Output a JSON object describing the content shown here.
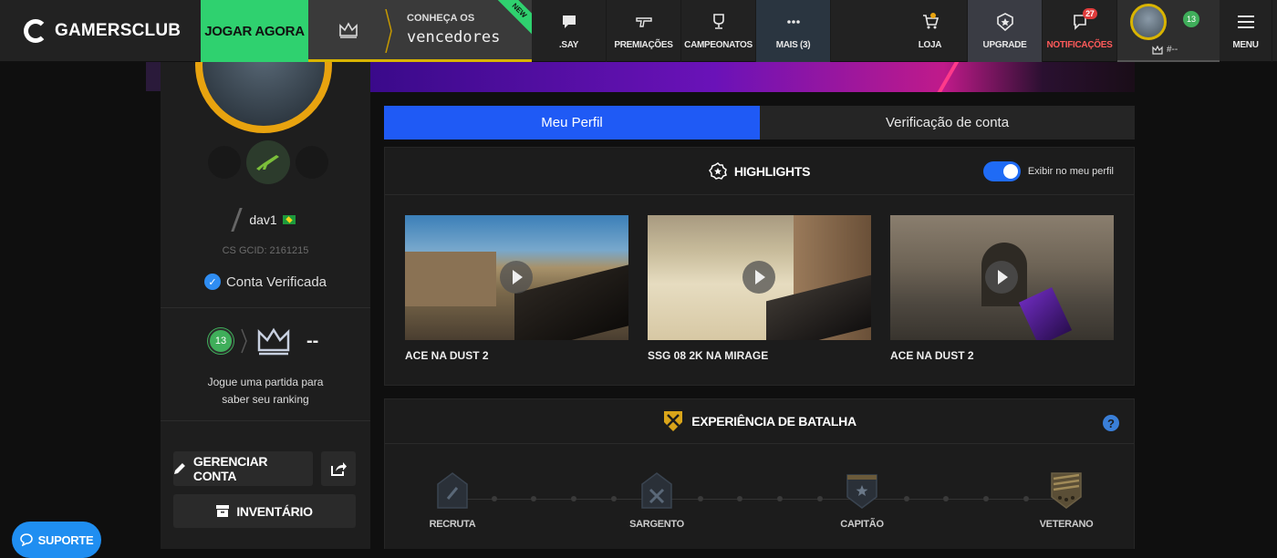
{
  "brand": {
    "name": "GAMERSCLUB"
  },
  "topnav": {
    "play_now": "JOGAR AGORA",
    "promo": {
      "line1": "CONHEÇA OS",
      "line2": "vencedores",
      "ribbon": "NEW"
    },
    "items": [
      {
        "label": ".SAY",
        "icon": "chat-icon"
      },
      {
        "label": "PREMIAÇÕES",
        "icon": "gun-icon"
      },
      {
        "label": "CAMPEONATOS",
        "icon": "trophy-icon"
      },
      {
        "label": "MAIS (3)",
        "icon": "more-dots-icon"
      },
      {
        "label": "LOJA",
        "icon": "cart-icon"
      },
      {
        "label": "UPGRADE",
        "icon": "upgrade-shield-icon"
      },
      {
        "label": "NOTIFICAÇÕES",
        "icon": "bell-icon",
        "badge": "27"
      }
    ],
    "user": {
      "level": "13",
      "rank": "#--"
    },
    "menu_label": "MENU"
  },
  "sidebar": {
    "nickname": "dav1",
    "gcid": "CS GCID: 2161215",
    "verified": "Conta Verificada",
    "level": "13",
    "rank_value": "--",
    "rank_message_1": "Jogue uma partida para",
    "rank_message_2": "saber seu ranking",
    "manage_button": "GERENCIAR CONTA",
    "inventory_button": "INVENTÁRIO"
  },
  "support_button": "SUPORTE",
  "tabs": [
    {
      "label": "Meu Perfil",
      "active": true
    },
    {
      "label": "Verificação de conta",
      "active": false
    }
  ],
  "highlights": {
    "title": "HIGHLIGHTS",
    "toggle_label": "Exibir no meu perfil",
    "toggle_on": true,
    "videos": [
      {
        "title": "ACE NA DUST 2"
      },
      {
        "title": "SSG 08 2K NA MIRAGE"
      },
      {
        "title": "ACE NA DUST 2"
      }
    ]
  },
  "battle": {
    "title": "EXPERIÊNCIA DE BATALHA",
    "milestones": [
      "RECRUTA",
      "SARGENTO",
      "CAPITÃO",
      "VETERANO"
    ]
  },
  "colors": {
    "accent_blue": "#1f5af5",
    "play_green": "#2fd16f",
    "gold": "#e8a30f"
  }
}
